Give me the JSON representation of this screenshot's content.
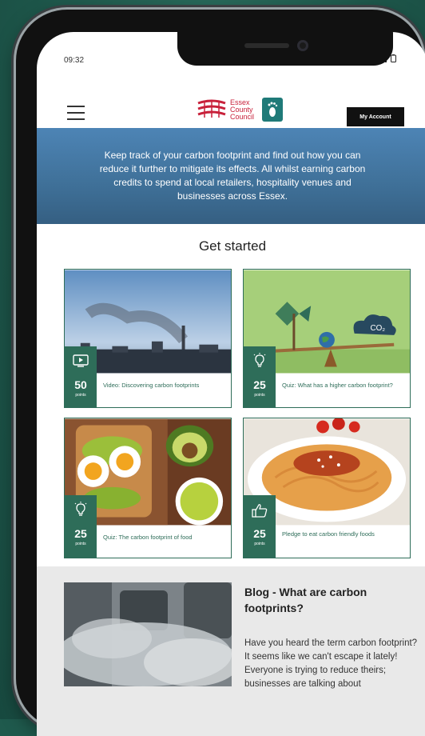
{
  "status": {
    "time": "09:32"
  },
  "header": {
    "logo_lines": [
      "Essex",
      "County",
      "Council"
    ],
    "account_label": "My Account"
  },
  "banner": {
    "text": "Keep track of your carbon footprint and find out how you can reduce it further to mitigate its effects. All whilst earning carbon credits to spend at local retailers, hospitality venues and businesses across Essex."
  },
  "get_started": {
    "title": "Get started",
    "cards": [
      {
        "points": "50",
        "points_label": "points",
        "title": "Video: Discovering carbon footprints",
        "icon": "video-icon"
      },
      {
        "points": "25",
        "points_label": "points",
        "title": "Quiz: What has a higher carbon footprint?",
        "icon": "lightbulb-icon"
      },
      {
        "points": "25",
        "points_label": "points",
        "title": "Quiz: The carbon footprint of food",
        "icon": "lightbulb-icon"
      },
      {
        "points": "25",
        "points_label": "points",
        "title": "Pledge to eat carbon friendly foods",
        "icon": "thumbs-up-icon"
      }
    ],
    "co2_label": "CO₂"
  },
  "blog": {
    "title": "Blog - What are carbon footprints?",
    "text": "Have you heard the term carbon footprint? It seems like we can't escape it lately! Everyone is trying to reduce theirs; businesses are talking about"
  },
  "colors": {
    "brand_green": "#2e6d59",
    "banner_blue": "#4d84b5",
    "council_red": "#c8213b",
    "background": "#1f5a4d"
  }
}
